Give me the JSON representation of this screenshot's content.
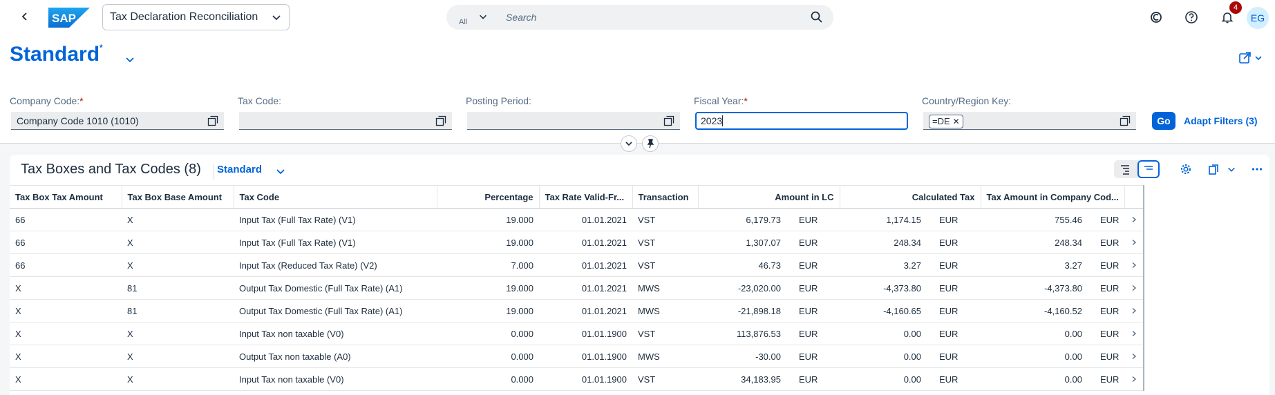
{
  "shell": {
    "app_title": "Tax Declaration Reconciliation",
    "search_scope": "All",
    "search_placeholder": "Search",
    "notification_count": "4",
    "user_initials": "EG"
  },
  "header": {
    "variant_name": "Standard",
    "variant_modified": "*",
    "filters": [
      {
        "label": "Company Code:",
        "required": "*",
        "value": "Company Code 1010 (1010)"
      },
      {
        "label": "Tax Code:",
        "required": "",
        "value": ""
      },
      {
        "label": "Posting Period:",
        "required": "",
        "value": ""
      },
      {
        "label": "Fiscal Year:",
        "required": "*",
        "value": "2023"
      },
      {
        "label": "Country/Region Key:",
        "required": "",
        "token": "=DE"
      }
    ],
    "go_label": "Go",
    "adapt_label": "Adapt Filters (3)"
  },
  "table": {
    "title": "Tax Boxes and Tax Codes (8)",
    "variant": "Standard",
    "columns": [
      "Tax Box Tax Amount",
      "Tax Box Base Amount",
      "Tax Code",
      "Percentage",
      "Tax Rate Valid-Fr...",
      "Transaction",
      "Amount in LC",
      "Calculated Tax",
      "Tax Amount in Company Cod..."
    ],
    "rows": [
      [
        "66",
        "X",
        "Input Tax (Full Tax Rate) (V1)",
        "19.000",
        "01.01.2021",
        "VST",
        "6,179.73",
        "EUR",
        "1,174.15",
        "EUR",
        "755.46",
        "EUR"
      ],
      [
        "66",
        "X",
        "Input Tax (Full Tax Rate) (V1)",
        "19.000",
        "01.01.2021",
        "VST",
        "1,307.07",
        "EUR",
        "248.34",
        "EUR",
        "248.34",
        "EUR"
      ],
      [
        "66",
        "X",
        "Input Tax (Reduced Tax Rate) (V2)",
        "7.000",
        "01.01.2021",
        "VST",
        "46.73",
        "EUR",
        "3.27",
        "EUR",
        "3.27",
        "EUR"
      ],
      [
        "X",
        "81",
        "Output Tax Domestic (Full Tax Rate) (A1)",
        "19.000",
        "01.01.2021",
        "MWS",
        "-23,020.00",
        "EUR",
        "-4,373.80",
        "EUR",
        "-4,373.80",
        "EUR"
      ],
      [
        "X",
        "81",
        "Output Tax Domestic (Full Tax Rate) (A1)",
        "19.000",
        "01.01.2021",
        "MWS",
        "-21,898.18",
        "EUR",
        "-4,160.65",
        "EUR",
        "-4,160.52",
        "EUR"
      ],
      [
        "X",
        "X",
        "Input Tax non taxable (V0)",
        "0.000",
        "01.01.1900",
        "VST",
        "113,876.53",
        "EUR",
        "0.00",
        "EUR",
        "0.00",
        "EUR"
      ],
      [
        "X",
        "X",
        "Output Tax non taxable (A0)",
        "0.000",
        "01.01.1900",
        "MWS",
        "-30.00",
        "EUR",
        "0.00",
        "EUR",
        "0.00",
        "EUR"
      ],
      [
        "X",
        "X",
        "Input Tax non taxable (V0)",
        "0.000",
        "01.01.1900",
        "VST",
        "34,183.95",
        "EUR",
        "0.00",
        "EUR",
        "0.00",
        "EUR"
      ]
    ]
  },
  "colors": {
    "brand": "#0064d9",
    "required": "#aa0808"
  }
}
